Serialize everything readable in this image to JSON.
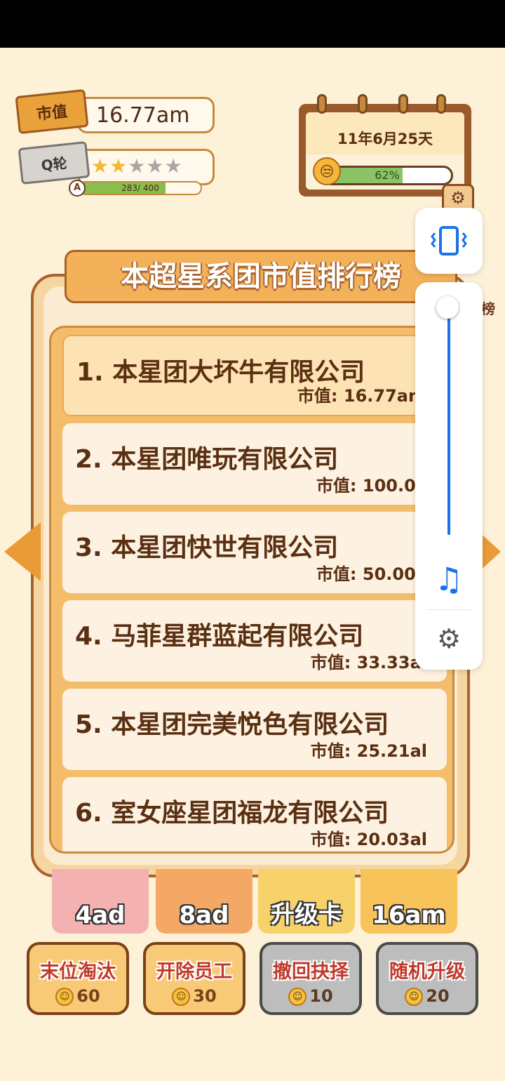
{
  "header": {
    "market_value_tag": "市值",
    "market_value": "16.77am",
    "round_tag": "Q轮",
    "stars_filled": 2,
    "stars_total": 5,
    "grade": "A",
    "xp_text": "283/ 400",
    "xp_fraction": 0.7075
  },
  "calendar": {
    "date": "11年6月25天",
    "mood_percent_text": "62%",
    "mood_fraction": 0.62
  },
  "panel": {
    "title": "本超星系团市值排行榜",
    "side_label": "榜",
    "rankings": [
      {
        "name": "1. 本星团大坏牛有限公司",
        "value": "市值: 16.77am"
      },
      {
        "name": "2. 本星团唯玩有限公司",
        "value": "市值: 100.0a"
      },
      {
        "name": "3. 本星团快世有限公司",
        "value": "市值: 50.00a"
      },
      {
        "name": "4. 马菲星群蓝起有限公司",
        "value": "市值: 33.33al"
      },
      {
        "name": "5. 本星团完美悦色有限公司",
        "value": "市值: 25.21al"
      },
      {
        "name": "6. 室女座星团福龙有限公司",
        "value": "市值: 20.03al"
      }
    ]
  },
  "cards": [
    {
      "label": "4ad",
      "color": "#f4b1b1"
    },
    {
      "label": "8ad",
      "color": "#f3a866"
    },
    {
      "label": "升级卡",
      "color": "#f7d26a"
    },
    {
      "label": "16am",
      "color": "#f8c35a"
    }
  ],
  "actions": [
    {
      "label": "末位淘汰",
      "cost": "60",
      "state": "active"
    },
    {
      "label": "开除员工",
      "cost": "30",
      "state": "active"
    },
    {
      "label": "撤回抉择",
      "cost": "10",
      "state": "disabled"
    },
    {
      "label": "随机升级",
      "cost": "20",
      "state": "disabled"
    }
  ],
  "volume_overlay": {
    "vibrate_icon": "vibrate-icon",
    "music_icon": "music-note-icon",
    "settings_icon": "settings-gear-icon",
    "level_fraction": 1.0,
    "accent": "#1a73e8"
  }
}
